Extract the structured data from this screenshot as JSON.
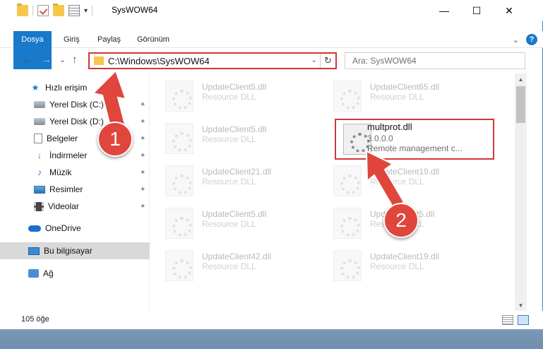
{
  "titlebar": {
    "title": "SysWOW64",
    "quick_dropdown": "▾",
    "minimize": "—",
    "maximize": "☐",
    "close": "✕"
  },
  "ribbon": {
    "tabs": [
      {
        "label": "Dosya"
      },
      {
        "label": "Giriş"
      },
      {
        "label": "Paylaş"
      },
      {
        "label": "Görünüm"
      }
    ],
    "collapse": "⌄",
    "help": "?"
  },
  "nav": {
    "back": "←",
    "forward": "→",
    "recent": "⌄",
    "up": "↑",
    "address": "C:\\Windows\\SysWOW64",
    "address_dropdown": "⌄",
    "refresh": "↻",
    "search_placeholder": "Ara: SysWOW64"
  },
  "sidebar": {
    "items": [
      {
        "label": "Hızlı erişim",
        "icon": "star-icon"
      },
      {
        "label": "Yerel Disk (C:)",
        "icon": "drive-icon"
      },
      {
        "label": "Yerel Disk (D:)",
        "icon": "drive-icon"
      },
      {
        "label": "Belgeler",
        "icon": "documents-icon"
      },
      {
        "label": "İndirmeler",
        "icon": "download-icon"
      },
      {
        "label": "Müzik",
        "icon": "music-icon"
      },
      {
        "label": "Resimler",
        "icon": "pictures-icon"
      },
      {
        "label": "Videolar",
        "icon": "videos-icon"
      },
      {
        "label": "OneDrive",
        "icon": "cloud-icon"
      },
      {
        "label": "Bu bilgisayar",
        "icon": "computer-icon"
      },
      {
        "label": "Ağ",
        "icon": "network-icon"
      }
    ],
    "pin_glyph": "📌"
  },
  "files": [
    {
      "name": "UpdateClient5.dll",
      "type": "Resource DLL"
    },
    {
      "name": "UpdateClient65.dll",
      "type": "Resource DLL"
    },
    {
      "name": "UpdateClient5.dll",
      "type": "Resource DLL"
    },
    {
      "name": "multprot.dll",
      "version": "3.0.0.0",
      "desc": "Remote management c..."
    },
    {
      "name": "UpdateClient21.dll",
      "type": "Resource DLL"
    },
    {
      "name": "UpdateClient19.dll",
      "type": "Resource DLL"
    },
    {
      "name": "UpdateClient5.dll",
      "type": "Resource DLL"
    },
    {
      "name": "UpdateClient5.dll",
      "type": "Resource DLL"
    },
    {
      "name": "UpdateClient42.dll",
      "type": "Resource DLL"
    },
    {
      "name": "UpdateClient19.dll",
      "type": "Resource DLL"
    }
  ],
  "status": {
    "count": "105 öğe"
  },
  "annotations": {
    "step1": "1",
    "step2": "2",
    "color": "#e0463c"
  }
}
